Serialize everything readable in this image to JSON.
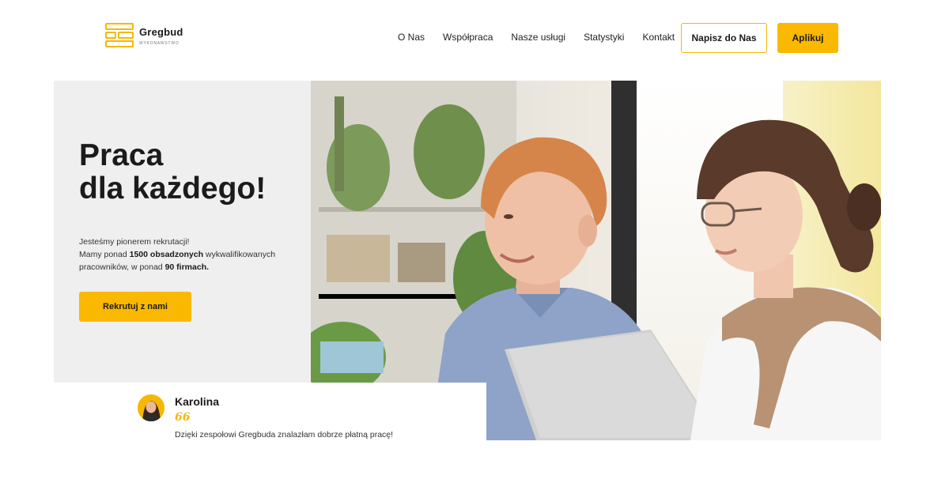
{
  "brand": {
    "name": "Gregbud",
    "tagline": "WYKONAWSTWO",
    "accent": "#fbb800"
  },
  "nav": {
    "items": [
      {
        "label": "O Nas"
      },
      {
        "label": "Współpraca"
      },
      {
        "label": "Nasze usługi"
      },
      {
        "label": "Statystyki"
      },
      {
        "label": "Kontakt"
      }
    ],
    "contact_button": "Napisz do Nas",
    "apply_button": "Aplikuj"
  },
  "hero": {
    "title_line1": "Praca",
    "title_line2": "dla każdego!",
    "desc_line1": "Jesteśmy pionerem rekrutacji!",
    "desc_line2_pre": "Mamy ponad ",
    "desc_line2_bold": "1500 obsadzonych",
    "desc_line2_post": " wykwalifikowanych",
    "desc_line3_pre": "pracowników, w ponad ",
    "desc_line3_bold": "90 firmach.",
    "cta_button": "Rekrutuj z nami"
  },
  "testimonial": {
    "name": "Karolina",
    "quote_mark": "66",
    "text": "Dzięki zespołowi Gregbuda znalazłam dobrze płatną pracę!"
  }
}
